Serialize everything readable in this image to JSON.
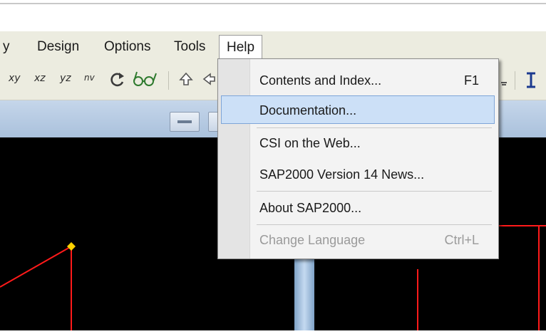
{
  "menubar": {
    "items": [
      {
        "label": "y"
      },
      {
        "label": "Design"
      },
      {
        "label": "Options"
      },
      {
        "label": "Tools"
      },
      {
        "label": "Help"
      }
    ]
  },
  "toolbar": {
    "view_buttons": [
      "xy",
      "xz",
      "yz",
      "nv"
    ]
  },
  "help_menu": {
    "items": [
      {
        "label": "Contents and Index...",
        "shortcut": "F1",
        "enabled": true
      },
      {
        "label": "Documentation...",
        "shortcut": "",
        "enabled": true,
        "highlighted": true
      },
      {
        "label": "CSI on the Web...",
        "shortcut": "",
        "enabled": true
      },
      {
        "label": "SAP2000 Version 14 News...",
        "shortcut": "",
        "enabled": true
      },
      {
        "label": "About SAP2000...",
        "shortcut": "",
        "enabled": true
      },
      {
        "label": "Change Language",
        "shortcut": "Ctrl+L",
        "enabled": false
      }
    ]
  },
  "colors": {
    "menu_background": "#ecece0",
    "canvas_background": "#000000",
    "highlight": "#cce0f7",
    "model_lines": "#ff1a1a",
    "joint_marker": "#ffd200"
  }
}
